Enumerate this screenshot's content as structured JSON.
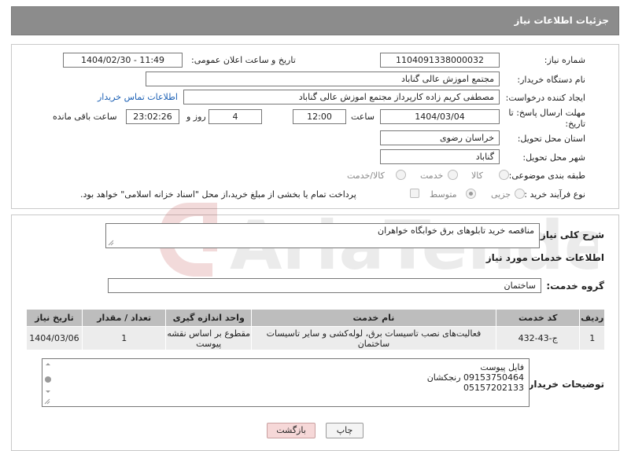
{
  "header": {
    "title": "جزئیات اطلاعات نیاز"
  },
  "form": {
    "need_number_label": "شماره نیاز:",
    "need_number": "1104091338000032",
    "announce_label": "تاریخ و ساعت اعلان عمومی:",
    "announce_value": "1404/02/30 - 11:49",
    "buyer_org_label": "نام دستگاه خریدار:",
    "buyer_org": "مجتمع اموزش عالی گناباد",
    "requester_label": "ایجاد کننده درخواست:",
    "requester": "مصطفی کریم زاده کارپرداز مجتمع اموزش عالی گناباد",
    "contact_link": "اطلاعات تماس خریدار",
    "deadline_label_line1": "مهلت ارسال پاسخ: تا",
    "deadline_label_line2": "تاریخ:",
    "deadline_date": "1404/03/04",
    "time_label": "ساعت",
    "deadline_time": "12:00",
    "days_value": "4",
    "days_label": "روز و",
    "remaining_time": "23:02:26",
    "remaining_label": "ساعت باقی مانده",
    "province_label": "استان محل تحویل:",
    "province": "خراسان رضوی",
    "city_label": "شهر محل تحویل:",
    "city": "گناباد",
    "category_label": "طبقه بندی موضوعی:",
    "category_options": [
      "کالا",
      "خدمت",
      "کالا/خدمت"
    ],
    "purchase_type_label": "نوع فرآیند خرید :",
    "purchase_options": [
      "جزیی",
      "متوسط"
    ],
    "payment_note": "پرداخت تمام یا بخشی از مبلغ خرید،از محل \"اسناد خزانه اسلامی\" خواهد بود."
  },
  "summary": {
    "label": "شرح کلی نیاز:",
    "value": "مناقصه خرید تابلوهای برق خوابگاه خواهران"
  },
  "services": {
    "section_title": "اطلاعات خدمات مورد نیاز",
    "group_label": "گروه خدمت:",
    "group_value": "ساختمان",
    "columns": [
      "ردیف",
      "کد خدمت",
      "نام خدمت",
      "واحد اندازه گیری",
      "تعداد / مقدار",
      "تاریخ نیاز"
    ],
    "rows": [
      {
        "row": "1",
        "code": "ج-43-432",
        "name": "فعالیت‌های نصب تاسیسات برق، لوله‌کشی و سایر تاسیسات ساختمان",
        "unit": "مقطوع بر اساس نقشه پیوست",
        "qty": "1",
        "date": "1404/03/06"
      }
    ]
  },
  "buyer_notes": {
    "label": "توضیحات خریدار:",
    "lines": [
      "فایل پیوست",
      "09153750464  رنجکشان",
      "05157202133"
    ]
  },
  "buttons": {
    "print": "چاپ",
    "back": "بازگشت"
  },
  "watermark": {
    "text": "AriaTender.net"
  }
}
